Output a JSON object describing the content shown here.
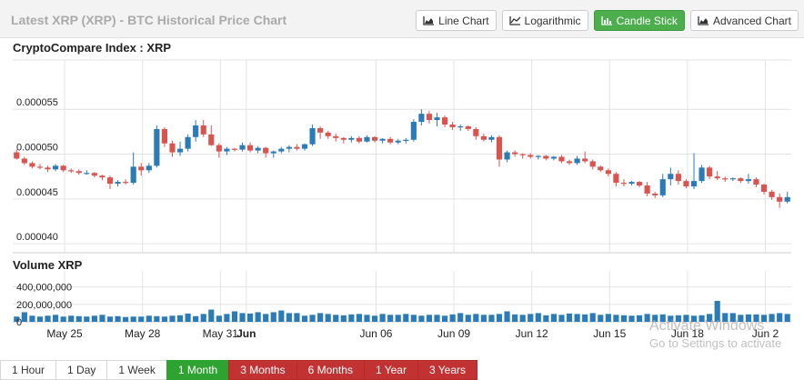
{
  "header": {
    "title": "Latest XRP (XRP) - BTC Historical Price Chart",
    "buttons": [
      {
        "label": "Line Chart",
        "icon": "area-chart-icon",
        "active": false
      },
      {
        "label": "Logarithmic",
        "icon": "line-chart-icon",
        "active": false
      },
      {
        "label": "Candle Stick",
        "icon": "bar-chart-icon",
        "active": true
      },
      {
        "label": "Advanced Chart",
        "icon": "area-chart-icon",
        "active": false
      }
    ]
  },
  "colors": {
    "up": "#2b7bb9",
    "down": "#d9534f",
    "volume": "#2b7bb9",
    "grid": "#e3e3e3",
    "active_green": "#2fa332",
    "red": "#c23232"
  },
  "chart_data": {
    "type": "candlestick",
    "price_title": "CryptoCompare Index : XRP",
    "volume_title": "Volume XRP",
    "ylim": [
      3.9e-05,
      6.05e-05
    ],
    "y_ticks": [
      {
        "value": 5.5e-05,
        "label": "0.000055"
      },
      {
        "value": 5e-05,
        "label": "0.000050"
      },
      {
        "value": 4.5e-05,
        "label": "0.000045"
      },
      {
        "value": 4e-05,
        "label": "0.000040"
      }
    ],
    "volume_ylim": [
      0,
      500000000
    ],
    "volume_ticks": [
      {
        "value": 400000000,
        "label": "400,000,000"
      },
      {
        "value": 200000000,
        "label": "200,000,000"
      },
      {
        "value": 0,
        "label": "0"
      }
    ],
    "x_labels": [
      {
        "day": 2,
        "label": "May 25"
      },
      {
        "day": 5,
        "label": "May 28"
      },
      {
        "day": 8,
        "label": "May 31"
      },
      {
        "day": 9,
        "label": "Jun"
      },
      {
        "day": 14,
        "label": "Jun 06"
      },
      {
        "day": 17,
        "label": "Jun 09"
      },
      {
        "day": 20,
        "label": "Jun 12"
      },
      {
        "day": 23,
        "label": "Jun 15"
      },
      {
        "day": 26,
        "label": "Jun 18"
      },
      {
        "day": 29,
        "label": "Jun 2"
      }
    ],
    "candles": [
      {
        "o": 5.02e-05,
        "h": 5.05e-05,
        "l": 4.94e-05,
        "c": 4.95e-05
      },
      {
        "o": 4.95e-05,
        "h": 4.97e-05,
        "l": 4.88e-05,
        "c": 4.9e-05
      },
      {
        "o": 4.9e-05,
        "h": 4.92e-05,
        "l": 4.84e-05,
        "c": 4.86e-05
      },
      {
        "o": 4.86e-05,
        "h": 4.89e-05,
        "l": 4.83e-05,
        "c": 4.85e-05
      },
      {
        "o": 4.85e-05,
        "h": 4.87e-05,
        "l": 4.8e-05,
        "c": 4.83e-05
      },
      {
        "o": 4.83e-05,
        "h": 4.89e-05,
        "l": 4.81e-05,
        "c": 4.87e-05
      },
      {
        "o": 4.87e-05,
        "h": 4.88e-05,
        "l": 4.8e-05,
        "c": 4.82e-05
      },
      {
        "o": 4.82e-05,
        "h": 4.84e-05,
        "l": 4.79e-05,
        "c": 4.81e-05
      },
      {
        "o": 4.81e-05,
        "h": 4.83e-05,
        "l": 4.77e-05,
        "c": 4.79e-05
      },
      {
        "o": 4.79e-05,
        "h": 4.82e-05,
        "l": 4.77e-05,
        "c": 4.79e-05
      },
      {
        "o": 4.79e-05,
        "h": 4.8e-05,
        "l": 4.74e-05,
        "c": 4.76e-05
      },
      {
        "o": 4.76e-05,
        "h": 4.77e-05,
        "l": 4.71e-05,
        "c": 4.74e-05
      },
      {
        "o": 4.74e-05,
        "h": 4.76e-05,
        "l": 4.61e-05,
        "c": 4.67e-05
      },
      {
        "o": 4.67e-05,
        "h": 4.71e-05,
        "l": 4.64e-05,
        "c": 4.69e-05
      },
      {
        "o": 4.69e-05,
        "h": 4.72e-05,
        "l": 4.66e-05,
        "c": 4.68e-05
      },
      {
        "o": 4.68e-05,
        "h": 5.02e-05,
        "l": 4.66e-05,
        "c": 4.86e-05
      },
      {
        "o": 4.86e-05,
        "h": 4.9e-05,
        "l": 4.76e-05,
        "c": 4.82e-05
      },
      {
        "o": 4.82e-05,
        "h": 4.9e-05,
        "l": 4.79e-05,
        "c": 4.87e-05
      },
      {
        "o": 4.87e-05,
        "h": 5.32e-05,
        "l": 4.85e-05,
        "c": 5.28e-05
      },
      {
        "o": 5.28e-05,
        "h": 5.3e-05,
        "l": 5.08e-05,
        "c": 5.12e-05
      },
      {
        "o": 5.12e-05,
        "h": 5.15e-05,
        "l": 4.97e-05,
        "c": 5.02e-05
      },
      {
        "o": 5.02e-05,
        "h": 5.14e-05,
        "l": 4.98e-05,
        "c": 5.06e-05
      },
      {
        "o": 5.06e-05,
        "h": 5.22e-05,
        "l": 5.03e-05,
        "c": 5.19e-05
      },
      {
        "o": 5.19e-05,
        "h": 5.38e-05,
        "l": 5.14e-05,
        "c": 5.32e-05
      },
      {
        "o": 5.32e-05,
        "h": 5.38e-05,
        "l": 5.19e-05,
        "c": 5.22e-05
      },
      {
        "o": 5.22e-05,
        "h": 5.32e-05,
        "l": 5.09e-05,
        "c": 5.1e-05
      },
      {
        "o": 5.1e-05,
        "h": 5.12e-05,
        "l": 4.96e-05,
        "c": 5.03e-05
      },
      {
        "o": 5.03e-05,
        "h": 5.08e-05,
        "l": 4.99e-05,
        "c": 5.06e-05
      },
      {
        "o": 5.06e-05,
        "h": 5.07e-05,
        "l": 5.03e-05,
        "c": 5.05e-05
      },
      {
        "o": 5.05e-05,
        "h": 5.13e-05,
        "l": 5.03e-05,
        "c": 5.1e-05
      },
      {
        "o": 5.1e-05,
        "h": 5.13e-05,
        "l": 5.02e-05,
        "c": 5.04e-05
      },
      {
        "o": 5.04e-05,
        "h": 5.09e-05,
        "l": 5.01e-05,
        "c": 5.07e-05
      },
      {
        "o": 5.07e-05,
        "h": 5.08e-05,
        "l": 4.96e-05,
        "c": 5.01e-05
      },
      {
        "o": 5.01e-05,
        "h": 5.04e-05,
        "l": 4.96e-05,
        "c": 5.03e-05
      },
      {
        "o": 5.03e-05,
        "h": 5.08e-05,
        "l": 5.01e-05,
        "c": 5.06e-05
      },
      {
        "o": 5.06e-05,
        "h": 5.1e-05,
        "l": 5.02e-05,
        "c": 5.08e-05
      },
      {
        "o": 5.08e-05,
        "h": 5.11e-05,
        "l": 5.04e-05,
        "c": 5.06e-05
      },
      {
        "o": 5.06e-05,
        "h": 5.12e-05,
        "l": 5.04e-05,
        "c": 5.11e-05
      },
      {
        "o": 5.11e-05,
        "h": 5.33e-05,
        "l": 5.09e-05,
        "c": 5.29e-05
      },
      {
        "o": 5.29e-05,
        "h": 5.31e-05,
        "l": 5.17e-05,
        "c": 5.24e-05
      },
      {
        "o": 5.24e-05,
        "h": 5.26e-05,
        "l": 5.17e-05,
        "c": 5.2e-05
      },
      {
        "o": 5.2e-05,
        "h": 5.23e-05,
        "l": 5.14e-05,
        "c": 5.18e-05
      },
      {
        "o": 5.18e-05,
        "h": 5.19e-05,
        "l": 5.12e-05,
        "c": 5.16e-05
      },
      {
        "o": 5.16e-05,
        "h": 5.2e-05,
        "l": 5.13e-05,
        "c": 5.18e-05
      },
      {
        "o": 5.18e-05,
        "h": 5.2e-05,
        "l": 5.12e-05,
        "c": 5.14e-05
      },
      {
        "o": 5.14e-05,
        "h": 5.21e-05,
        "l": 5.13e-05,
        "c": 5.19e-05
      },
      {
        "o": 5.19e-05,
        "h": 5.2e-05,
        "l": 5.13e-05,
        "c": 5.15e-05
      },
      {
        "o": 5.15e-05,
        "h": 5.18e-05,
        "l": 5.12e-05,
        "c": 5.17e-05
      },
      {
        "o": 5.17e-05,
        "h": 5.19e-05,
        "l": 5.11e-05,
        "c": 5.13e-05
      },
      {
        "o": 5.13e-05,
        "h": 5.17e-05,
        "l": 5.11e-05,
        "c": 5.15e-05
      },
      {
        "o": 5.15e-05,
        "h": 5.18e-05,
        "l": 5.12e-05,
        "c": 5.16e-05
      },
      {
        "o": 5.16e-05,
        "h": 5.39e-05,
        "l": 5.14e-05,
        "c": 5.36e-05
      },
      {
        "o": 5.36e-05,
        "h": 5.5e-05,
        "l": 5.32e-05,
        "c": 5.45e-05
      },
      {
        "o": 5.45e-05,
        "h": 5.48e-05,
        "l": 5.34e-05,
        "c": 5.38e-05
      },
      {
        "o": 5.38e-05,
        "h": 5.46e-05,
        "l": 5.31e-05,
        "c": 5.41e-05
      },
      {
        "o": 5.41e-05,
        "h": 5.43e-05,
        "l": 5.3e-05,
        "c": 5.33e-05
      },
      {
        "o": 5.33e-05,
        "h": 5.36e-05,
        "l": 5.27e-05,
        "c": 5.3e-05
      },
      {
        "o": 5.3e-05,
        "h": 5.33e-05,
        "l": 5.26e-05,
        "c": 5.31e-05
      },
      {
        "o": 5.31e-05,
        "h": 5.32e-05,
        "l": 5.26e-05,
        "c": 5.28e-05
      },
      {
        "o": 5.28e-05,
        "h": 5.3e-05,
        "l": 5.16e-05,
        "c": 5.2e-05
      },
      {
        "o": 5.2e-05,
        "h": 5.23e-05,
        "l": 5.14e-05,
        "c": 5.16e-05
      },
      {
        "o": 5.16e-05,
        "h": 5.21e-05,
        "l": 5.13e-05,
        "c": 5.19e-05
      },
      {
        "o": 5.19e-05,
        "h": 5.21e-05,
        "l": 4.86e-05,
        "c": 4.94e-05
      },
      {
        "o": 4.94e-05,
        "h": 5.04e-05,
        "l": 4.91e-05,
        "c": 5.02e-05
      },
      {
        "o": 5.02e-05,
        "h": 5.04e-05,
        "l": 4.97e-05,
        "c": 5e-05
      },
      {
        "o": 5e-05,
        "h": 5.01e-05,
        "l": 4.95e-05,
        "c": 4.99e-05
      },
      {
        "o": 4.99e-05,
        "h": 5.01e-05,
        "l": 4.95e-05,
        "c": 4.97e-05
      },
      {
        "o": 4.97e-05,
        "h": 4.99e-05,
        "l": 4.94e-05,
        "c": 4.98e-05
      },
      {
        "o": 4.98e-05,
        "h": 4.99e-05,
        "l": 4.93e-05,
        "c": 4.95e-05
      },
      {
        "o": 4.95e-05,
        "h": 4.98e-05,
        "l": 4.93e-05,
        "c": 4.97e-05
      },
      {
        "o": 4.97e-05,
        "h": 4.99e-05,
        "l": 4.9e-05,
        "c": 4.92e-05
      },
      {
        "o": 4.92e-05,
        "h": 4.94e-05,
        "l": 4.88e-05,
        "c": 4.9e-05
      },
      {
        "o": 4.9e-05,
        "h": 4.98e-05,
        "l": 4.88e-05,
        "c": 4.95e-05
      },
      {
        "o": 4.95e-05,
        "h": 5.03e-05,
        "l": 4.9e-05,
        "c": 4.92e-05
      },
      {
        "o": 4.92e-05,
        "h": 4.94e-05,
        "l": 4.83e-05,
        "c": 4.86e-05
      },
      {
        "o": 4.86e-05,
        "h": 4.87e-05,
        "l": 4.8e-05,
        "c": 4.82e-05
      },
      {
        "o": 4.82e-05,
        "h": 4.84e-05,
        "l": 4.75e-05,
        "c": 4.78e-05
      },
      {
        "o": 4.78e-05,
        "h": 4.8e-05,
        "l": 4.64e-05,
        "c": 4.68e-05
      },
      {
        "o": 4.68e-05,
        "h": 4.72e-05,
        "l": 4.64e-05,
        "c": 4.67e-05
      },
      {
        "o": 4.67e-05,
        "h": 4.7e-05,
        "l": 4.65e-05,
        "c": 4.69e-05
      },
      {
        "o": 4.69e-05,
        "h": 4.7e-05,
        "l": 4.63e-05,
        "c": 4.65e-05
      },
      {
        "o": 4.65e-05,
        "h": 4.69e-05,
        "l": 4.53e-05,
        "c": 4.56e-05
      },
      {
        "o": 4.56e-05,
        "h": 4.58e-05,
        "l": 4.51e-05,
        "c": 4.54e-05
      },
      {
        "o": 4.54e-05,
        "h": 4.78e-05,
        "l": 4.52e-05,
        "c": 4.72e-05
      },
      {
        "o": 4.72e-05,
        "h": 4.85e-05,
        "l": 4.65e-05,
        "c": 4.78e-05
      },
      {
        "o": 4.78e-05,
        "h": 4.82e-05,
        "l": 4.66e-05,
        "c": 4.7e-05
      },
      {
        "o": 4.7e-05,
        "h": 4.72e-05,
        "l": 4.62e-05,
        "c": 4.64e-05
      },
      {
        "o": 4.64e-05,
        "h": 5.01e-05,
        "l": 4.61e-05,
        "c": 4.7e-05
      },
      {
        "o": 4.7e-05,
        "h": 4.88e-05,
        "l": 4.68e-05,
        "c": 4.85e-05
      },
      {
        "o": 4.85e-05,
        "h": 4.87e-05,
        "l": 4.72e-05,
        "c": 4.75e-05
      },
      {
        "o": 4.75e-05,
        "h": 4.81e-05,
        "l": 4.71e-05,
        "c": 4.73e-05
      },
      {
        "o": 4.73e-05,
        "h": 4.75e-05,
        "l": 4.69e-05,
        "c": 4.72e-05
      },
      {
        "o": 4.72e-05,
        "h": 4.74e-05,
        "l": 4.7e-05,
        "c": 4.73e-05
      },
      {
        "o": 4.73e-05,
        "h": 4.74e-05,
        "l": 4.68e-05,
        "c": 4.7e-05
      },
      {
        "o": 4.7e-05,
        "h": 4.78e-05,
        "l": 4.67e-05,
        "c": 4.72e-05
      },
      {
        "o": 4.72e-05,
        "h": 4.74e-05,
        "l": 4.63e-05,
        "c": 4.66e-05
      },
      {
        "o": 4.66e-05,
        "h": 4.67e-05,
        "l": 4.55e-05,
        "c": 4.58e-05
      },
      {
        "o": 4.58e-05,
        "h": 4.6e-05,
        "l": 4.49e-05,
        "c": 4.52e-05
      },
      {
        "o": 4.52e-05,
        "h": 4.56e-05,
        "l": 4.4e-05,
        "c": 4.47e-05
      },
      {
        "o": 4.47e-05,
        "h": 4.58e-05,
        "l": 4.45e-05,
        "c": 4.52e-05
      }
    ],
    "volumes": [
      60,
      110,
      70,
      60,
      70,
      80,
      60,
      70,
      65,
      60,
      70,
      80,
      60,
      65,
      55,
      60,
      60,
      70,
      65,
      60,
      70,
      75,
      95,
      65,
      90,
      140,
      70,
      90,
      120,
      100,
      95,
      110,
      90,
      110,
      130,
      100,
      100,
      70,
      80,
      100,
      90,
      80,
      75,
      85,
      90,
      80,
      70,
      90,
      80,
      80,
      90,
      80,
      70,
      80,
      80,
      70,
      85,
      100,
      80,
      90,
      80,
      80,
      90,
      120,
      85,
      80,
      90,
      100,
      75,
      90,
      80,
      95,
      90,
      85,
      100,
      80,
      90,
      80,
      75,
      70,
      75,
      90,
      80,
      85,
      70,
      75,
      80,
      70,
      75,
      90,
      240,
      100,
      100,
      80,
      85,
      85,
      80,
      90,
      100,
      90
    ]
  },
  "range_buttons": [
    {
      "label": "1 Hour",
      "style": "default"
    },
    {
      "label": "1 Day",
      "style": "default"
    },
    {
      "label": "1 Week",
      "style": "default"
    },
    {
      "label": "1 Month",
      "style": "active"
    },
    {
      "label": "3 Months",
      "style": "red"
    },
    {
      "label": "6 Months",
      "style": "red"
    },
    {
      "label": "1 Year",
      "style": "red"
    },
    {
      "label": "3 Years",
      "style": "red"
    }
  ],
  "watermark": {
    "line1": "Activate Windows",
    "line2": "Go to Settings to activate"
  }
}
